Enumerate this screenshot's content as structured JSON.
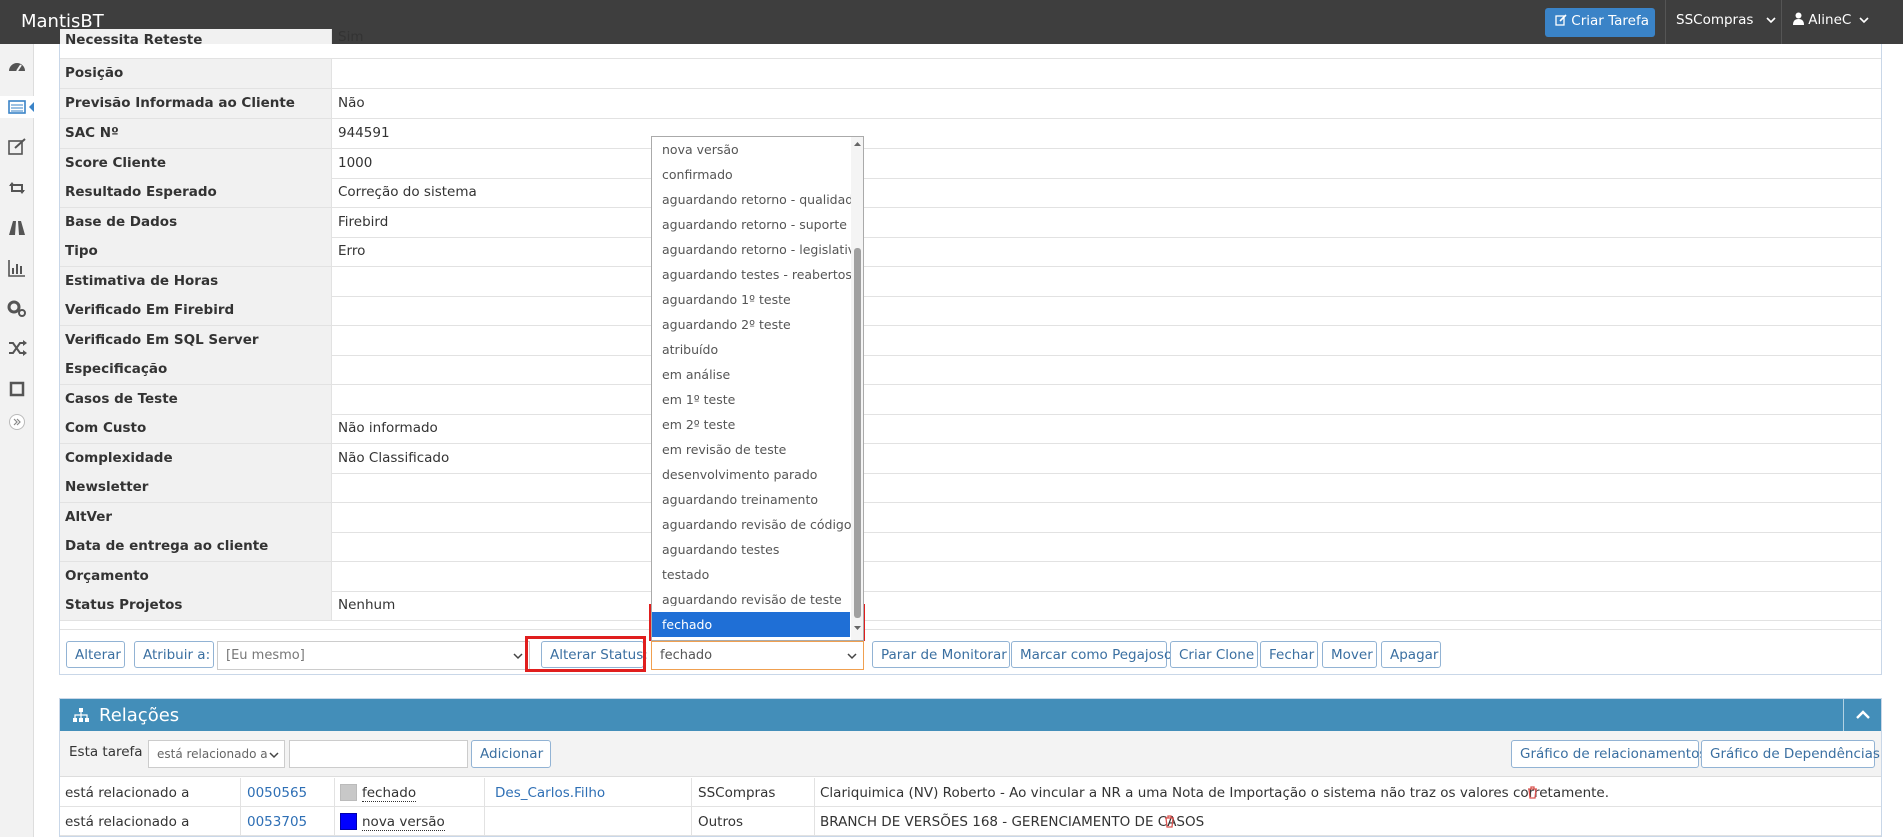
{
  "app": {
    "title": "MantisBT"
  },
  "navbar": {
    "create_label": "Criar Tarefa",
    "project": "SSCompras",
    "user": "AlineC"
  },
  "sidebar": {
    "icons": [
      "dashboard-icon",
      "list-icon",
      "edit-icon",
      "retweet-icon",
      "road-icon",
      "chart-icon",
      "cogs-icon",
      "random-icon",
      "window-icon",
      "collapse-icon"
    ]
  },
  "fields": [
    {
      "label": "Necessita Reteste",
      "value": "Sim"
    },
    {
      "label": "Posição",
      "value": ""
    },
    {
      "label": "Previsão Informada ao Cliente",
      "value": "Não"
    },
    {
      "label": "SAC Nº",
      "value": "944591"
    },
    {
      "label": "Score Cliente",
      "value": "1000"
    },
    {
      "label": "Resultado Esperado",
      "value": "Correção do sistema"
    },
    {
      "label": "Base de Dados",
      "value": "Firebird"
    },
    {
      "label": "Tipo",
      "value": "Erro"
    },
    {
      "label": "Estimativa de Horas",
      "value": ""
    },
    {
      "label": "Verificado Em Firebird",
      "value": ""
    },
    {
      "label": "Verificado Em SQL Server",
      "value": ""
    },
    {
      "label": "Especificação",
      "value": ""
    },
    {
      "label": "Casos de Teste",
      "value": ""
    },
    {
      "label": "Com Custo",
      "value": "Não informado"
    },
    {
      "label": "Complexidade",
      "value": "Não Classificado"
    },
    {
      "label": "Newsletter",
      "value": ""
    },
    {
      "label": "AltVer",
      "value": ""
    },
    {
      "label": "Data de entrega ao cliente",
      "value": ""
    },
    {
      "label": "Orçamento",
      "value": ""
    },
    {
      "label": "Status Projetos",
      "value": "Nenhum"
    }
  ],
  "actions": {
    "alterar": "Alterar",
    "atribuir": "Atribuir a:",
    "assignee_value": "[Eu mesmo]",
    "alterar_status": "Alterar Status:",
    "status_value": "fechado",
    "monitorar": "Parar de Monitorar",
    "pegajoso": "Marcar como Pegajoso",
    "clone": "Criar Clone",
    "fechar": "Fechar",
    "mover": "Mover",
    "apagar": "Apagar"
  },
  "status_dropdown": {
    "options": [
      "nova versão",
      "confirmado",
      "aguardando retorno - qualidade",
      "aguardando retorno - suporte",
      "aguardando retorno - legislativo",
      "aguardando testes - reabertos",
      "aguardando 1º teste",
      "aguardando 2º teste",
      "atribuído",
      "em análise",
      "em 1º teste",
      "em 2º teste",
      "em revisão de teste",
      "desenvolvimento parado",
      "aguardando treinamento",
      "aguardando revisão de código",
      "aguardando testes",
      "testado",
      "aguardando revisão de teste",
      "fechado"
    ],
    "selected": "fechado"
  },
  "relations": {
    "title": "Relações",
    "label": "Esta tarefa",
    "relation_select": "está relacionado a",
    "add_label": "Adicionar",
    "graph_rel": "Gráfico de relacionamentos",
    "graph_dep": "Gráfico de Dependências",
    "rows": [
      {
        "relation": "está relacionado a",
        "id": "0050565",
        "status_color": "#c8c8c8",
        "status": "fechado",
        "handler": "Des_Carlos.Filho",
        "project": "SSCompras",
        "summary": "Clariquimica (NV) Roberto - Ao vincular a NR a uma Nota de Importação o sistema não traz os valores corretamente."
      },
      {
        "relation": "está relacionado a",
        "id": "0053705",
        "status_color": "#0000ff",
        "status": "nova versão",
        "handler": "",
        "project": "Outros",
        "summary": "BRANCH DE VERSÕES 168 - GERENCIAMENTO DE CASOS"
      }
    ]
  },
  "colors": {
    "navbar": "#3e3e3e",
    "primary": "#3a83c7",
    "widget_header": "#438eb9",
    "highlight_box": "#e01e1e",
    "selected_option": "#1f6fd6"
  }
}
